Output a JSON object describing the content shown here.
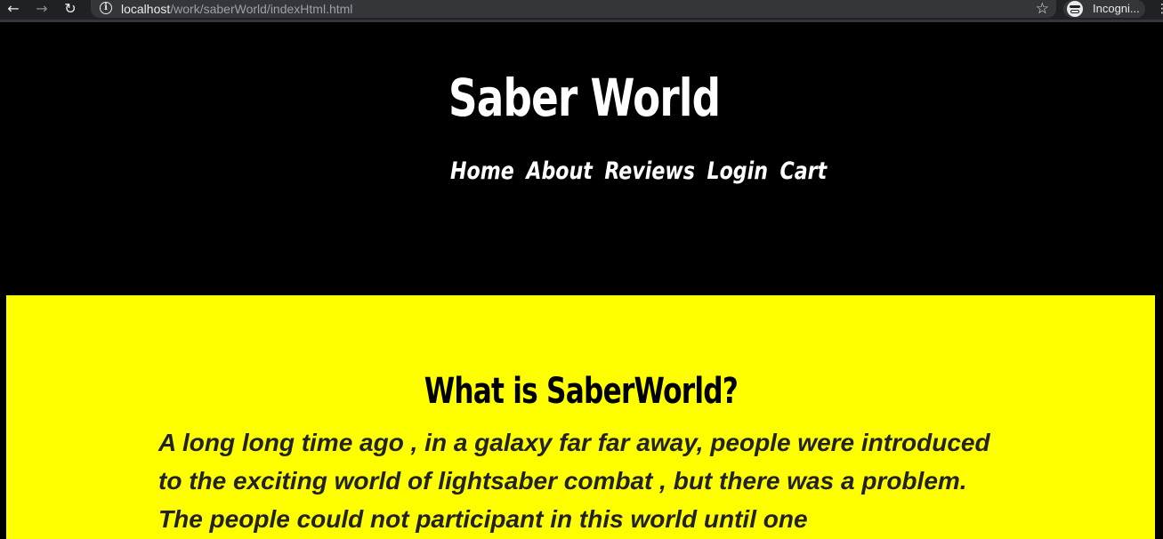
{
  "browser": {
    "back_icon": "arrow-left-icon",
    "forward_icon": "arrow-right-icon",
    "reload_icon": "reload-icon",
    "url_host": "localhost",
    "url_path": "/work/saberWorld/indexHtml.html",
    "bookmark_icon": "star-icon",
    "profile_label": "Incogni...",
    "colors": {
      "chrome": "#202124",
      "omnibox": "#35363a",
      "text": "#e8eaed"
    }
  },
  "header": {
    "title": "Saber World",
    "nav": [
      "Home",
      "About",
      "Reviews",
      "Login",
      "Cart"
    ],
    "background": "#000000",
    "text_color": "#ffffff"
  },
  "content": {
    "heading": "What is SaberWorld?",
    "body": "A long long time ago , in a galaxy far far away, people were introduced to the exciting world of lightsaber combat , but there was a problem. The people could not participant in this world until one",
    "background": "#ffff00"
  }
}
